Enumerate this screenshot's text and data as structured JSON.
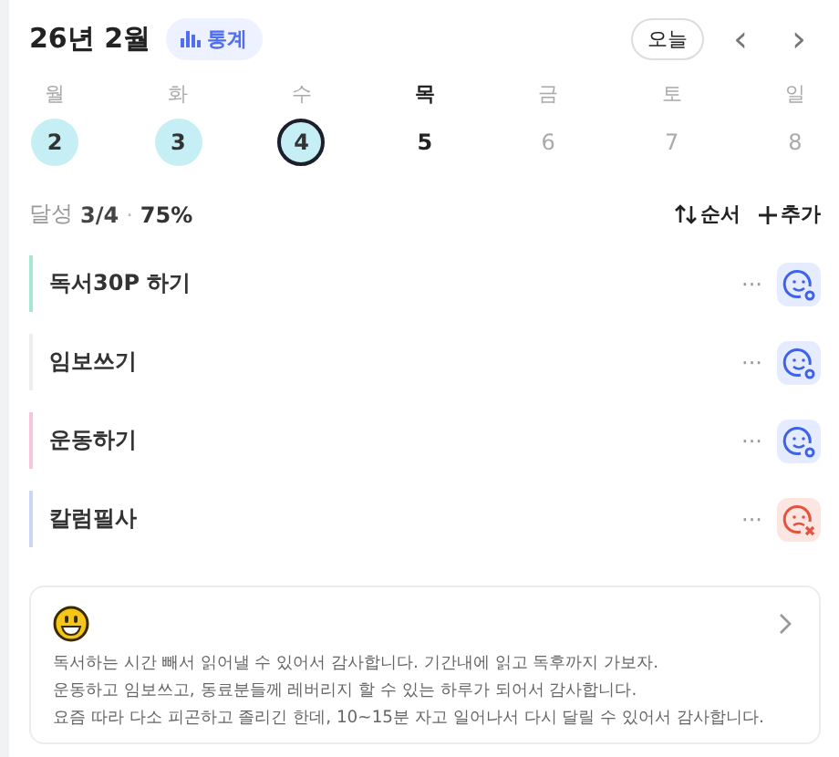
{
  "header": {
    "month": "26년 2월",
    "stats_button": "통계",
    "today_button": "오늘",
    "prev": "‹",
    "next": "›"
  },
  "days": [
    {
      "weekday": "월",
      "date": "2",
      "kind": "done",
      "selected": false
    },
    {
      "weekday": "화",
      "date": "3",
      "kind": "done",
      "selected": false
    },
    {
      "weekday": "수",
      "date": "4",
      "kind": "done",
      "selected": true
    },
    {
      "weekday": "목",
      "date": "5",
      "kind": "today",
      "selected": false
    },
    {
      "weekday": "금",
      "date": "6",
      "kind": "future",
      "selected": false
    },
    {
      "weekday": "토",
      "date": "7",
      "kind": "future",
      "selected": false
    },
    {
      "weekday": "일",
      "date": "8",
      "kind": "future",
      "selected": false
    }
  ],
  "summary": {
    "label": "달성",
    "count": "3/4",
    "separator": "·",
    "percent": "75%",
    "sort_button": "순서",
    "add_button": "추가"
  },
  "tasks": [
    {
      "title": "독서30P 하기",
      "color": "#a6e8cf",
      "kind": "done",
      "more": "···"
    },
    {
      "title": "임보쓰기",
      "color": "#eeeeee",
      "kind": "done",
      "more": "···"
    },
    {
      "title": "운동하기",
      "color": "#f7c6dd",
      "kind": "done",
      "more": "···"
    },
    {
      "title": "칼럼필사",
      "color": "#c9d6f5",
      "kind": "failed",
      "more": "···"
    }
  ],
  "journal": {
    "lines": [
      "독서하는 시간 빼서 읽어낼 수 있어서 감사합니다. 기간내에 읽고 독후까지 가보자.",
      "운동하고 임보쓰고, 동료분들께 레버리지 할 수 있는 하루가 되어서 감사합니다.",
      "요즘 따라 다소 피곤하고 졸리긴 한데, 10~15분 자고 일어나서 다시 달릴 수 있어서 감사합니다."
    ]
  }
}
